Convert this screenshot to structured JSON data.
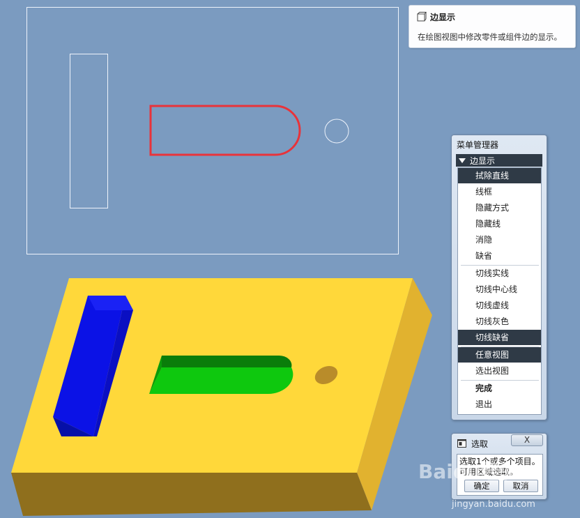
{
  "tooltip": {
    "title": "边显示",
    "description": "在绘图视图中修改零件或组件边的显示。",
    "icon": "edge-display-icon"
  },
  "menu_manager": {
    "title": "菜单管理器",
    "section": "边显示",
    "items": [
      {
        "label": "拭除直线",
        "selected": true
      },
      {
        "label": "线框",
        "selected": false
      },
      {
        "label": "隐藏方式",
        "selected": false
      },
      {
        "label": "隐藏线",
        "selected": false
      },
      {
        "label": "消隐",
        "selected": false
      },
      {
        "label": "缺省",
        "selected": false
      },
      {
        "label": "切线实线",
        "selected": false
      },
      {
        "label": "切线中心线",
        "selected": false
      },
      {
        "label": "切线虚线",
        "selected": false
      },
      {
        "label": "切线灰色",
        "selected": false
      },
      {
        "label": "切线缺省",
        "selected": true
      },
      {
        "label": "任意视图",
        "selected": true
      },
      {
        "label": "选出视图",
        "selected": false
      },
      {
        "label": "完成",
        "selected": false
      },
      {
        "label": "退出",
        "selected": false
      }
    ]
  },
  "select_dialog": {
    "title": "选取",
    "close_label": "X",
    "line1": "选取1个或多个项目。",
    "line2": "可用区域选取。",
    "ok_label": "确定",
    "cancel_label": "取消"
  },
  "watermark": {
    "brand": "Baidu经验",
    "url": "jingyan.baidu.com"
  },
  "colors": {
    "background": "#7b9bc0",
    "highlight_red": "#e8333a",
    "part_yellow": "#ffd83a",
    "block_blue": "#0b12e6",
    "slot_green": "#0ec80e"
  }
}
